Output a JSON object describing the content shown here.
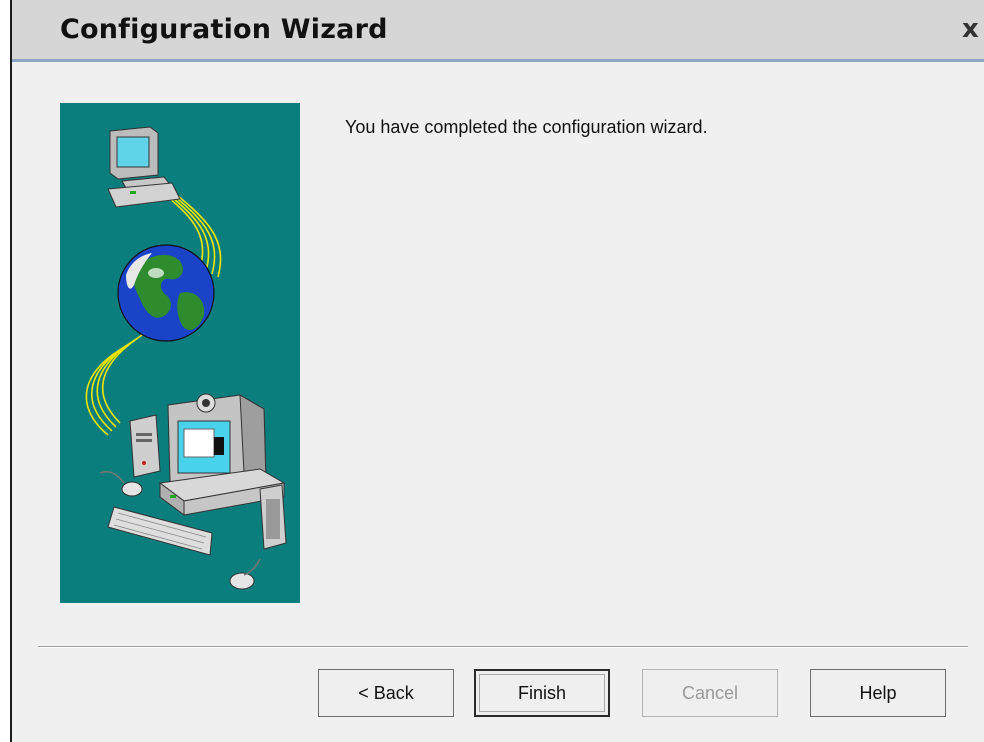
{
  "window": {
    "title": "Configuration Wizard",
    "close_label": "x"
  },
  "content": {
    "message": "You have completed the configuration wizard."
  },
  "buttons": {
    "back": "< Back",
    "finish": "Finish",
    "cancel": "Cancel",
    "help": "Help"
  },
  "colors": {
    "illustration_background": "#0a7d7d",
    "network_cable": "#f2e600"
  },
  "icons": {
    "illustration": "network-wizard-graphic",
    "close": "close-icon"
  }
}
